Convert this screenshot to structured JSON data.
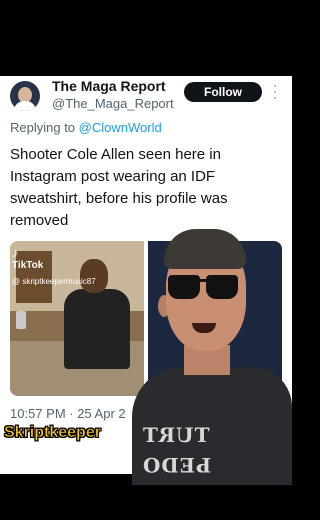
{
  "tweet": {
    "display_name": "The Maga Report",
    "handle": "@The_Maga_Report",
    "follow_label": "Follow",
    "more_icon": "⋮",
    "reply_prefix": "Replying to",
    "reply_to": "@ClownWorld",
    "text": "Shooter Cole Allen seen here in Instagram post wearing an IDF sweatshirt, before his profile was removed",
    "timestamp": "10:57 PM · 25 Apr 2"
  },
  "media": {
    "tiktok_label": "TikTok",
    "tiktok_user": "@ skriptkeepermusic87"
  },
  "overlay": {
    "watermark": "Skriptkeeper",
    "shirt_line1": "TURT",
    "shirt_line2": "PEDO"
  },
  "colors": {
    "accent": "#1d9bf0",
    "watermark": "#f5c518",
    "follow_bg": "#0f1419"
  }
}
